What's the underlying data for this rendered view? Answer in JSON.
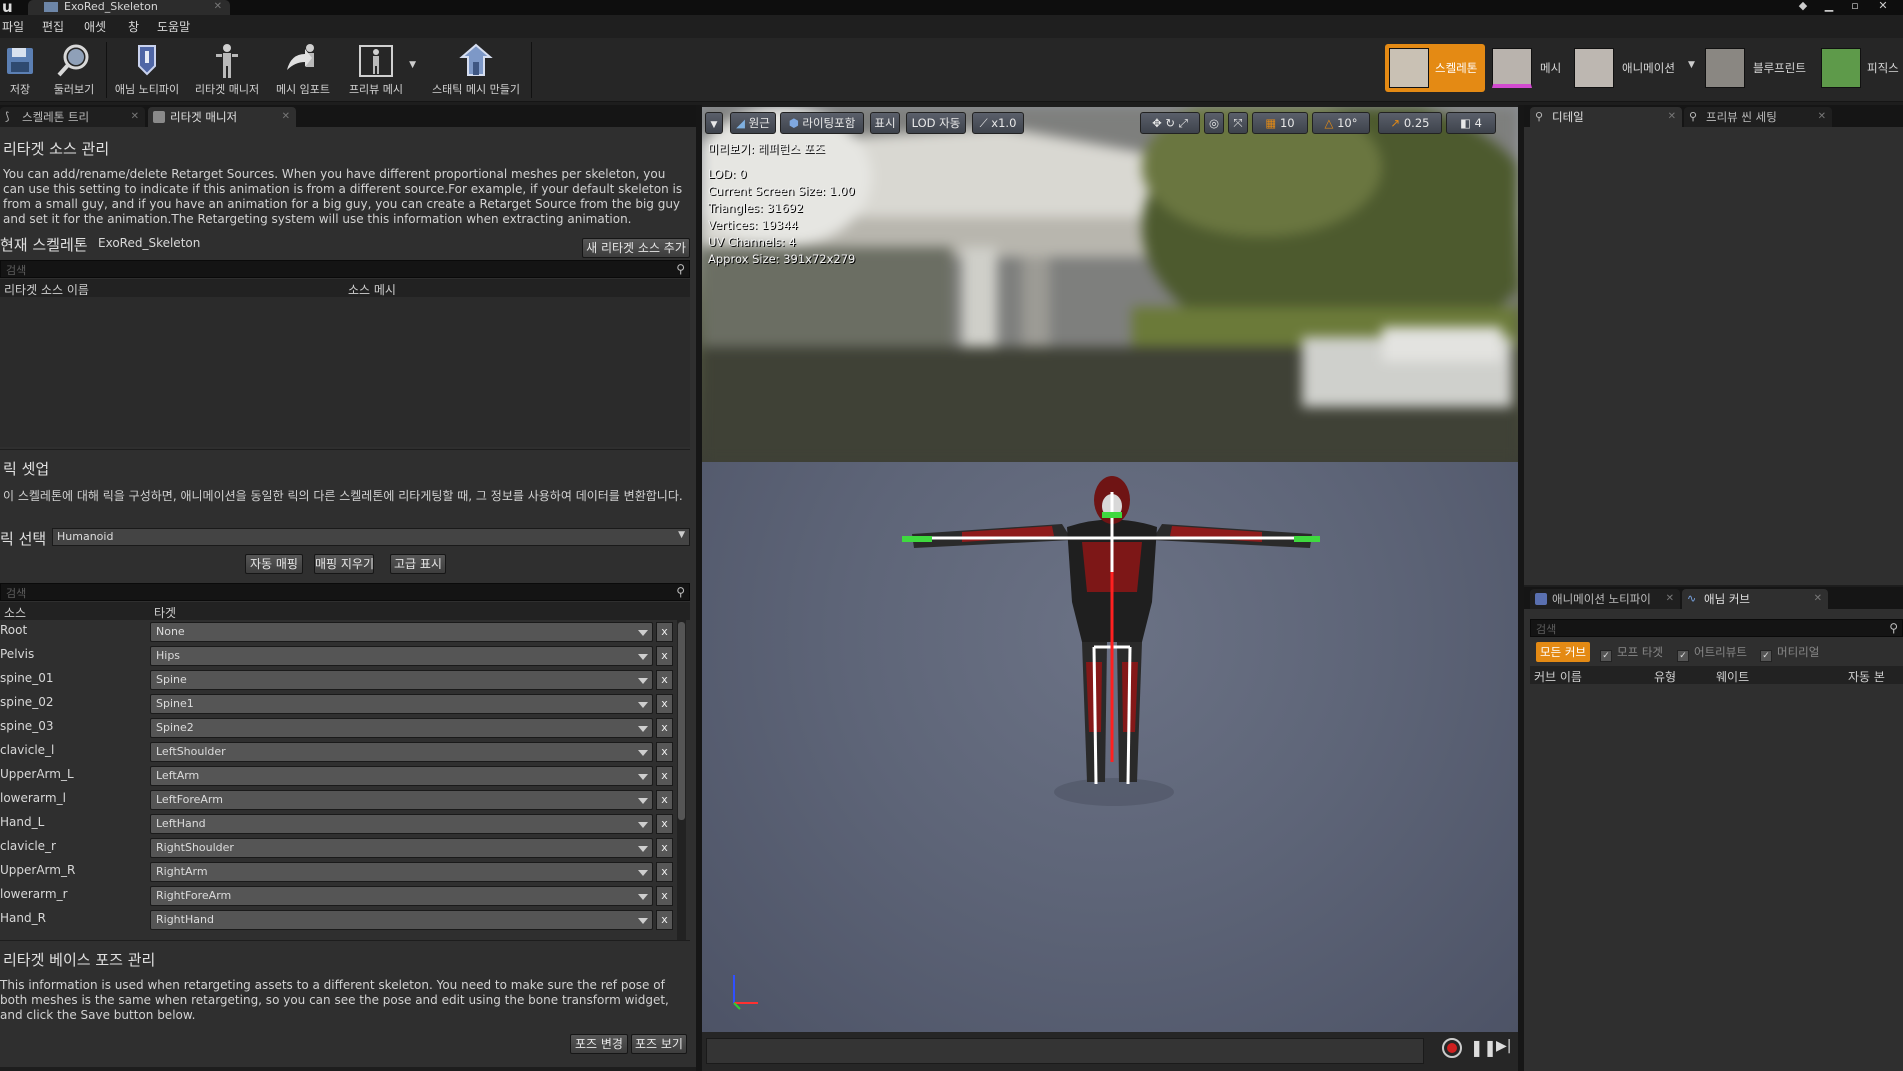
{
  "window": {
    "tab_title": "ExoRed_Skeleton",
    "logo": "u"
  },
  "menu": [
    "파일",
    "편집",
    "애셋",
    "창",
    "도움말"
  ],
  "toolbar": {
    "buttons": [
      {
        "label": "저장",
        "icon": "save-icon"
      },
      {
        "label": "둘러보기",
        "icon": "browse-icon"
      },
      {
        "label": "애님 노티파이",
        "icon": "anim-notify-icon"
      },
      {
        "label": "리타겟 매니저",
        "icon": "retarget-manager-icon"
      },
      {
        "label": "메시 임포트",
        "icon": "mesh-import-icon"
      },
      {
        "label": "프리뷰 메시",
        "icon": "preview-mesh-icon"
      },
      {
        "label": "스태틱 메시 만들기",
        "icon": "make-static-mesh-icon"
      }
    ],
    "modes": [
      {
        "label": "스켈레톤",
        "active": true
      },
      {
        "label": "메시",
        "active": false
      },
      {
        "label": "애니메이션",
        "active": false
      },
      {
        "label": "블루프린트",
        "active": false
      },
      {
        "label": "피직스",
        "active": false
      }
    ]
  },
  "left_tabs": [
    "스켈레톤 트리",
    "리타겟 매니저"
  ],
  "retarget_source": {
    "title": "리타겟 소스 관리",
    "description": "You can add/rename/delete Retarget Sources. When you have different proportional meshes per skeleton, you can use this setting to indicate if this animation is from a different source.For example, if your default skeleton is from a small guy, and if you have an animation for a big guy, you can create a Retarget Source from the big guy and set it for the animation.The Retargeting system will use this information when extracting animation.",
    "current_skeleton_label": "현재 스켈레톤",
    "current_skeleton_value": "ExoRed_Skeleton",
    "add_button": "새 리타겟 소스 추가",
    "search_placeholder": "검색",
    "col_name": "리타겟 소스 이름",
    "col_mesh": "소스 메시"
  },
  "rig_setup": {
    "title": "릭 셋업",
    "description": "이 스켈레톤에 대해 릭을 구성하면, 애니메이션을 동일한 릭의 다른 스켈레톤에 리타게팅할 때, 그 정보를 사용하여 데이터를 변환합니다.",
    "select_label": "릭 선택",
    "selected_rig": "Humanoid",
    "auto_map": "자동 매핑",
    "clear_map": "매핑 지우기",
    "advanced": "고급 표시",
    "search_placeholder": "검색",
    "col_source": "소스",
    "col_target": "타겟",
    "rows": [
      {
        "source": "Root",
        "target": "None"
      },
      {
        "source": "Pelvis",
        "target": "Hips"
      },
      {
        "source": "spine_01",
        "target": "Spine"
      },
      {
        "source": "spine_02",
        "target": "Spine1"
      },
      {
        "source": "spine_03",
        "target": "Spine2"
      },
      {
        "source": "clavicle_l",
        "target": "LeftShoulder"
      },
      {
        "source": "UpperArm_L",
        "target": "LeftArm"
      },
      {
        "source": "lowerarm_l",
        "target": "LeftForeArm"
      },
      {
        "source": "Hand_L",
        "target": "LeftHand"
      },
      {
        "source": "clavicle_r",
        "target": "RightShoulder"
      },
      {
        "source": "UpperArm_R",
        "target": "RightArm"
      },
      {
        "source": "lowerarm_r",
        "target": "RightForeArm"
      },
      {
        "source": "Hand_R",
        "target": "RightHand"
      }
    ],
    "remove_label": "x"
  },
  "base_pose": {
    "title": "리타겟 베이스 포즈 관리",
    "description": "This information is used when retargeting assets to a different skeleton. You need to make sure the ref pose of both meshes is the same when retargeting, so you can see the pose and edit using the bone transform widget, and click the Save button below.",
    "modify_button": "포즈 변경",
    "view_button": "포즈 보기"
  },
  "viewport": {
    "chips": [
      "원근",
      "라이팅포함",
      "표시",
      "LOD 자동",
      "x1.0"
    ],
    "grid_snap": "10",
    "rot_snap": "10°",
    "scale_snap": "0.25",
    "cam_speed": "4",
    "preview_label": "미리보기: 레퍼런스 포즈",
    "stats": [
      "LOD: 0",
      "Current Screen Size: 1.00",
      "Triangles: 31692",
      "Vertices: 19344",
      "UV Channels: 4",
      "Approx Size: 391x72x279"
    ]
  },
  "right_tabs_top": [
    "디테일",
    "프리뷰 씬 세팅"
  ],
  "right_tabs_bottom": [
    "애니메이션 노티파이",
    "애님 커브"
  ],
  "curves": {
    "search_placeholder": "검색",
    "filter_all": "모든 커브",
    "filter_morph": "모프 타겟",
    "filter_attr": "어트리뷰트",
    "filter_material": "머티리얼",
    "col_name": "커브 이름",
    "col_type": "유형",
    "col_weight": "웨이트",
    "col_bone": "자동 본"
  },
  "colors": {
    "accent": "#e48a14",
    "panel": "#2f2f2f",
    "viewport_floor": "#5e6578"
  }
}
